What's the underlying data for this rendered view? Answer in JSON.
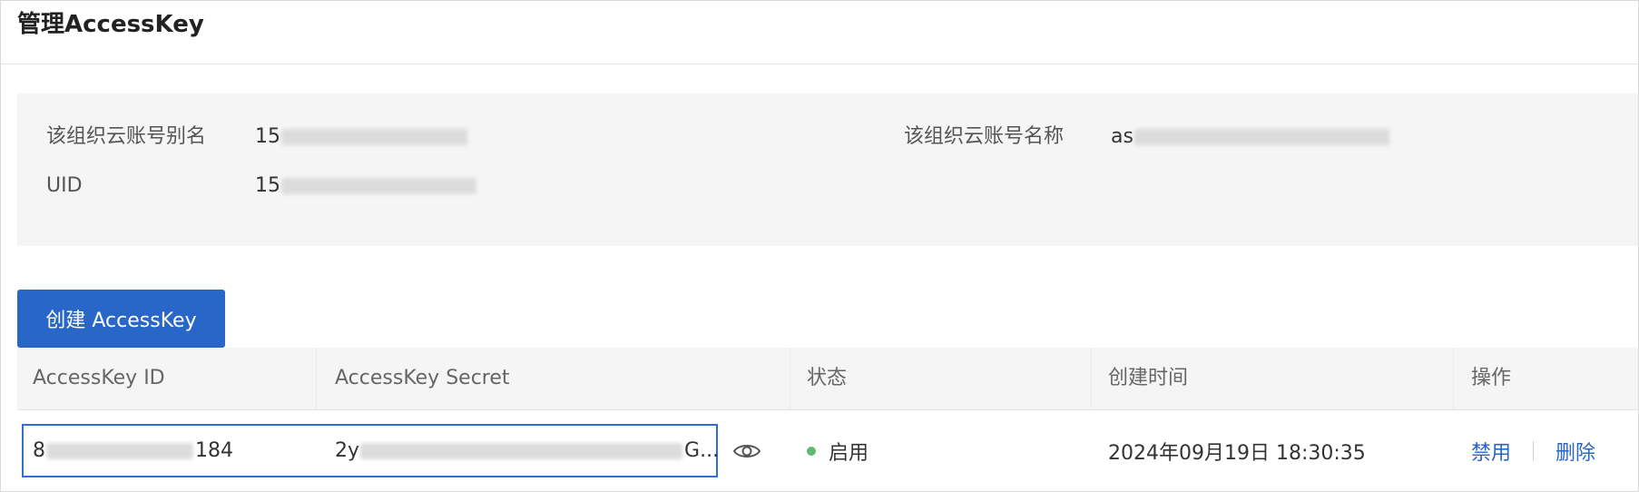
{
  "page": {
    "title": "管理AccessKey"
  },
  "account_info": {
    "alias_label": "该组织云账号别名",
    "alias_value": "15",
    "name_label": "该组织云账号名称",
    "name_value": "as",
    "uid_label": "UID",
    "uid_value": "15"
  },
  "actions": {
    "create_label": "创建 AccessKey"
  },
  "table": {
    "headers": [
      "AccessKey ID",
      "AccessKey Secret",
      "状态",
      "创建时间",
      "操作"
    ],
    "rows": [
      {
        "id_prefix": "8",
        "id_suffix": "184",
        "secret_prefix": "2y",
        "secret_suffix": "G...",
        "status": "启用",
        "created_at": "2024年09月19日 18:30:35",
        "op_disable": "禁用",
        "op_delete": "删除"
      }
    ]
  },
  "colors": {
    "primary": "#2866c8",
    "status_enabled": "#5cbb73"
  },
  "icons": {
    "reveal_secret": "eye-icon"
  }
}
